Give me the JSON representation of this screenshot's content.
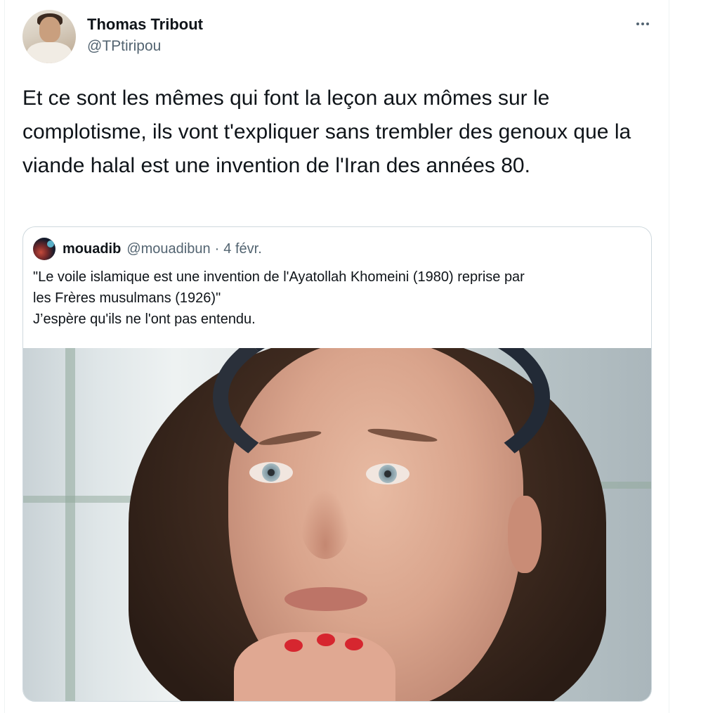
{
  "tweet": {
    "author": {
      "name": "Thomas Tribout",
      "handle": "@TPtiripou"
    },
    "text": "Et ce sont les mêmes qui font la leçon aux mômes sur le complotisme, ils vont t'expliquer sans trembler des genoux que la viande halal est une invention de l'Iran des années 80.",
    "more_icon": "more-horizontal-icon"
  },
  "quoted_tweet": {
    "author": {
      "name": "mouadib",
      "handle": "@mouadibun"
    },
    "separator": "·",
    "date": "4 févr.",
    "text_lines": [
      "\"Le voile islamique est une invention de l'Ayatollah Khomeini (1980) reprise par",
      "les Frères musulmans (1926)\"",
      "J’espère qu'ils ne l'ont pas entendu."
    ]
  },
  "colors": {
    "text_primary": "#0f1419",
    "text_secondary": "#536471",
    "border": "#cfd9de"
  }
}
